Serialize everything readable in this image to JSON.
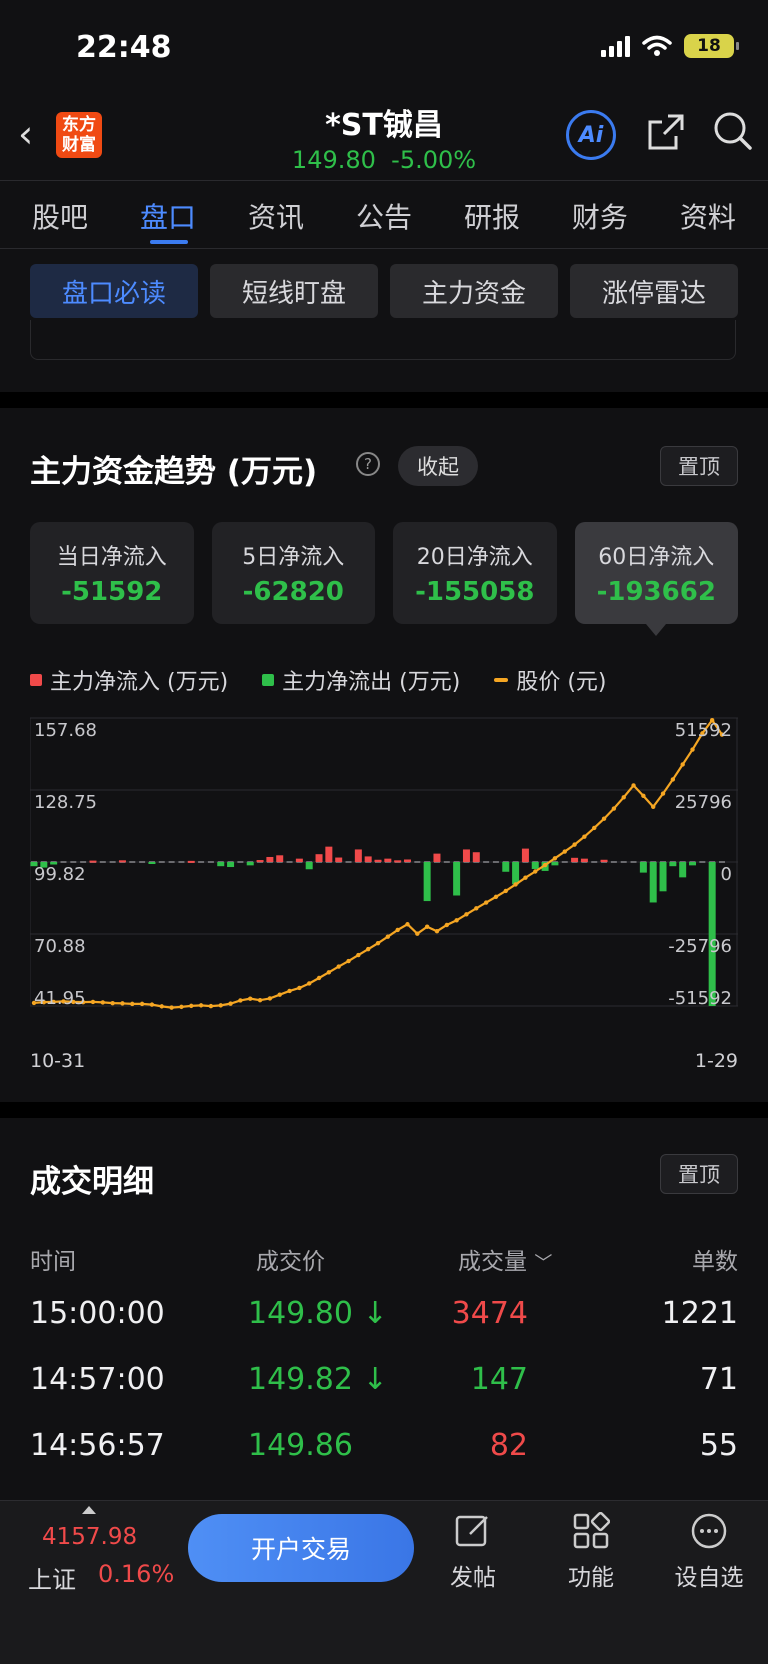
{
  "status": {
    "time": "22:48",
    "battery": "18"
  },
  "header": {
    "logo_line1": "东方",
    "logo_line2": "财富",
    "title": "*ST铖昌",
    "price": "149.80",
    "change": "-5.00%",
    "ai_label": "Ai"
  },
  "tabs": [
    "股吧",
    "盘口",
    "资讯",
    "公告",
    "研报",
    "财务",
    "资料"
  ],
  "active_tab": "盘口",
  "subtabs": [
    "盘口必读",
    "短线盯盘",
    "主力资金",
    "涨停雷达"
  ],
  "section": {
    "title": "主力资金趋势 (万元)",
    "help": "?",
    "collapse": "收起",
    "pin": "置顶"
  },
  "flow_cards": [
    {
      "label": "当日净流入",
      "value": "-51592"
    },
    {
      "label": "5日净流入",
      "value": "-62820"
    },
    {
      "label": "20日净流入",
      "value": "-155058"
    },
    {
      "label": "60日净流入",
      "value": "-193662"
    }
  ],
  "legend": {
    "inflow": "主力净流入 (万元)",
    "outflow": "主力净流出 (万元)",
    "price": "股价 (元)"
  },
  "colors": {
    "inflow": "#f04a4a",
    "outflow": "#2fbf4a",
    "price": "#f5a623",
    "accent": "#3b7bf0"
  },
  "chart_data": {
    "type": "bar+line",
    "x_start": "10-31",
    "x_end": "1-29",
    "left_axis_ticks": [
      "157.68",
      "128.75",
      "99.82",
      "70.88",
      "41.95"
    ],
    "right_axis_ticks": [
      "51592",
      "25796",
      "0",
      "-25796",
      "-51592"
    ],
    "left_ylim": [
      41.95,
      157.68
    ],
    "right_ylim": [
      -51592,
      51592
    ],
    "series": [
      {
        "name": "主力净流入 (万元)",
        "values": [
          -1500,
          -2000,
          -900,
          -700,
          -1200,
          -500,
          -400,
          -300,
          -600,
          -500,
          -400,
          -800,
          -600,
          -400,
          -500,
          -400,
          -300,
          -200,
          -700,
          -2000,
          -2300,
          -1800,
          -1200,
          -600,
          -400,
          -300,
          -200,
          -2600,
          -1200,
          -1800,
          -800,
          -300,
          -200,
          -1800,
          -6500,
          -7000,
          -6000,
          -5000,
          -4000,
          -9500,
          -3000,
          -2500,
          -1500,
          -800,
          -600,
          -900,
          -4000,
          -1500,
          -1200,
          -400,
          -300,
          -3000,
          -2500,
          -4500,
          -1000,
          -600,
          -400,
          -800,
          -1200,
          -800,
          -14000,
          -8000,
          -2000,
          -1000,
          -51592
        ]
      },
      {
        "name": "股价 (元)",
        "values": [
          43.2,
          43.5,
          43.6,
          43.8,
          43.6,
          43.5,
          43.6,
          43.4,
          43.1,
          43.0,
          42.8,
          42.8,
          42.5,
          41.8,
          41.3,
          41.6,
          42.0,
          42.2,
          41.9,
          42.2,
          42.9,
          44.2,
          44.9,
          44.3,
          45.0,
          46.5,
          48.0,
          49.2,
          51.0,
          53.2,
          55.5,
          57.8,
          60.0,
          62.4,
          64.8,
          67.2,
          69.8,
          72.5,
          74.8,
          71.0,
          73.8,
          72.0,
          74.5,
          76.4,
          78.8,
          81.2,
          83.5,
          85.8,
          88.2,
          90.8,
          93.5,
          96.0,
          98.6,
          101.3,
          104.0,
          106.8,
          110.0,
          113.5,
          117.2,
          121.3,
          125.8,
          130.6,
          126.4,
          122.0,
          127.3,
          133.0,
          139.0,
          145.0,
          151.5,
          156.8,
          151.0
        ]
      }
    ],
    "inflow_bars": [
      {
        "i": 6,
        "v": 500
      },
      {
        "i": 9,
        "v": 600
      },
      {
        "i": 16,
        "v": 400
      },
      {
        "i": 23,
        "v": 700
      },
      {
        "i": 24,
        "v": 1800
      },
      {
        "i": 25,
        "v": 2400
      },
      {
        "i": 27,
        "v": 1200
      },
      {
        "i": 29,
        "v": 2800
      },
      {
        "i": 30,
        "v": 5500
      },
      {
        "i": 31,
        "v": 1600
      },
      {
        "i": 33,
        "v": 4500
      },
      {
        "i": 34,
        "v": 2000
      },
      {
        "i": 35,
        "v": 800
      },
      {
        "i": 36,
        "v": 1200
      },
      {
        "i": 37,
        "v": 600
      },
      {
        "i": 38,
        "v": 900
      },
      {
        "i": 41,
        "v": 3000
      },
      {
        "i": 44,
        "v": 4500
      },
      {
        "i": 45,
        "v": 3500
      },
      {
        "i": 50,
        "v": 4800
      },
      {
        "i": 55,
        "v": 1500
      },
      {
        "i": 56,
        "v": 1200
      },
      {
        "i": 58,
        "v": 800
      }
    ],
    "outflow_bars": [
      {
        "i": 0,
        "v": 1500
      },
      {
        "i": 1,
        "v": 2000
      },
      {
        "i": 2,
        "v": 900
      },
      {
        "i": 12,
        "v": 600
      },
      {
        "i": 19,
        "v": 1500
      },
      {
        "i": 20,
        "v": 1800
      },
      {
        "i": 22,
        "v": 1200
      },
      {
        "i": 28,
        "v": 2600
      },
      {
        "i": 40,
        "v": 14000
      },
      {
        "i": 43,
        "v": 12000
      },
      {
        "i": 48,
        "v": 3500
      },
      {
        "i": 49,
        "v": 8000
      },
      {
        "i": 51,
        "v": 2500
      },
      {
        "i": 52,
        "v": 3200
      },
      {
        "i": 53,
        "v": 1200
      },
      {
        "i": 62,
        "v": 3800
      },
      {
        "i": 63,
        "v": 14500
      },
      {
        "i": 64,
        "v": 10500
      },
      {
        "i": 65,
        "v": 1500
      },
      {
        "i": 66,
        "v": 5500
      },
      {
        "i": 67,
        "v": 1200
      },
      {
        "i": 69,
        "v": 51592
      }
    ]
  },
  "trade": {
    "title": "成交明细",
    "pin": "置顶",
    "headers": {
      "time": "时间",
      "price": "成交价",
      "volume": "成交量",
      "count": "单数"
    },
    "rows": [
      {
        "time": "15:00:00",
        "price": "149.80 ↓",
        "volume": "3474",
        "count": "1221",
        "vol_color": "#f04a4a"
      },
      {
        "time": "14:57:00",
        "price": "149.82 ↓",
        "volume": "147",
        "count": "71",
        "vol_color": "#2fbf4a"
      },
      {
        "time": "14:56:57",
        "price": "149.86",
        "volume": "82",
        "count": "55",
        "vol_color": "#f04a4a"
      }
    ]
  },
  "bottom": {
    "index_value": "4157.98",
    "index_name": "上证",
    "index_change": "0.16%",
    "open_button": "开户交易",
    "nav": [
      "发帖",
      "功能",
      "设自选"
    ]
  }
}
